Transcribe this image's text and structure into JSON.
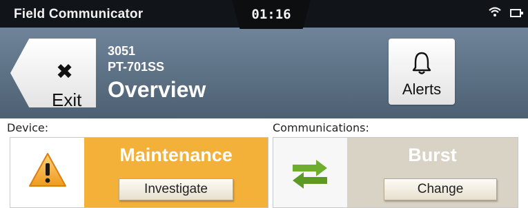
{
  "statusbar": {
    "app_title": "Field Communicator",
    "clock": "01:16",
    "icons": [
      "wifi-icon",
      "battery-icon"
    ]
  },
  "header": {
    "exit": {
      "icon": "close-icon",
      "label": "Exit"
    },
    "device_model": "3051",
    "device_tag": "PT-701SS",
    "page_title": "Overview",
    "alerts": {
      "icon": "bell-icon",
      "label": "Alerts"
    }
  },
  "device": {
    "section_label": "Device:",
    "icon": "warning-icon",
    "status": "Maintenance",
    "action": "Investigate",
    "status_color": "#f3b13a"
  },
  "communications": {
    "section_label": "Communications:",
    "icon": "transfer-arrows-icon",
    "status": "Burst",
    "action": "Change",
    "status_color": "#d9d3c5"
  }
}
